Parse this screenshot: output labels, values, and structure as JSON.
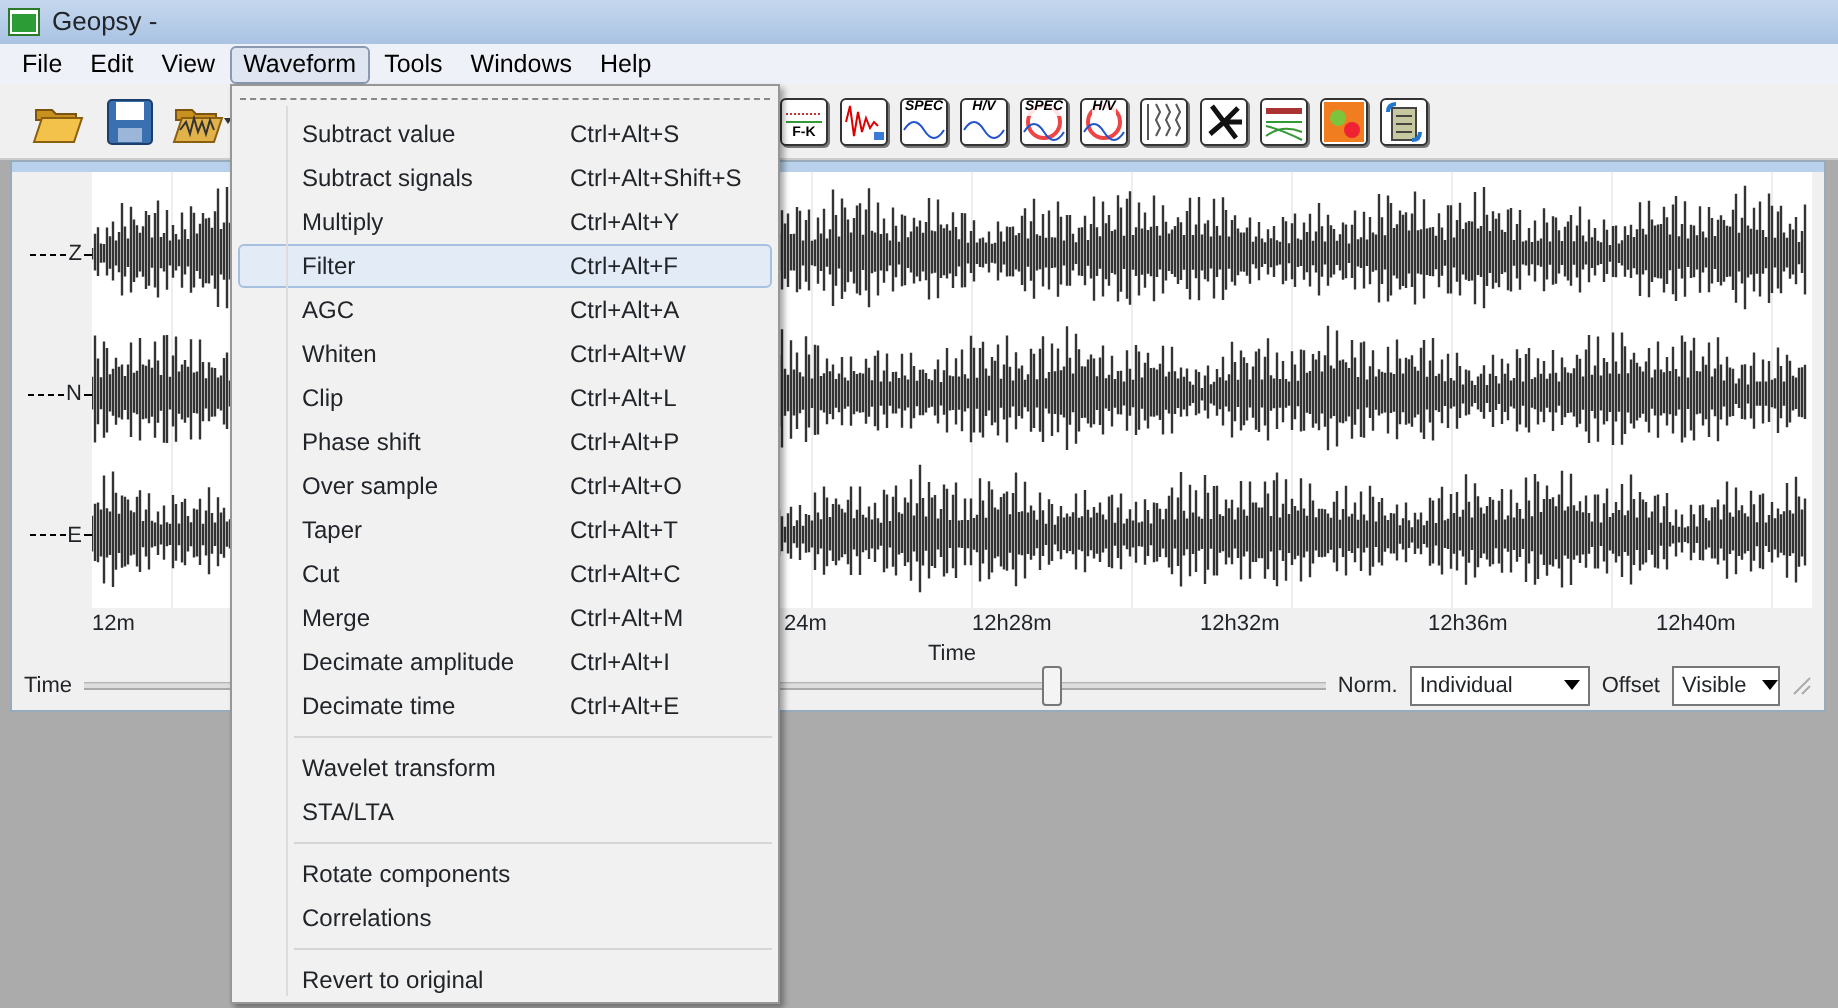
{
  "window": {
    "title": "Geopsy -"
  },
  "menubar": [
    {
      "label": "File",
      "selected": false
    },
    {
      "label": "Edit",
      "selected": false
    },
    {
      "label": "View",
      "selected": false
    },
    {
      "label": "Waveform",
      "selected": true
    },
    {
      "label": "Tools",
      "selected": false
    },
    {
      "label": "Windows",
      "selected": false
    },
    {
      "label": "Help",
      "selected": false
    }
  ],
  "toolbar": {
    "left": [
      {
        "kind": "open"
      },
      {
        "kind": "save"
      },
      {
        "kind": "load-signals"
      }
    ],
    "right": [
      {
        "kind": "fk",
        "label": "F-K"
      },
      {
        "kind": "damping"
      },
      {
        "kind": "spectrum",
        "label": "SPEC"
      },
      {
        "kind": "spectrum",
        "label": "H/V"
      },
      {
        "kind": "rotate-spectrum",
        "label": "SPEC"
      },
      {
        "kind": "rotate-spectrum",
        "label": "H/V"
      },
      {
        "kind": "traces"
      },
      {
        "kind": "polar"
      },
      {
        "kind": "dispersion"
      },
      {
        "kind": "map"
      },
      {
        "kind": "tables"
      }
    ]
  },
  "plot": {
    "traces": [
      {
        "label": "Z"
      },
      {
        "label": "N"
      },
      {
        "label": "E"
      }
    ],
    "x_ticks": [
      "12m",
      "24m",
      "12h28m",
      "12h32m",
      "12h36m",
      "12h40m"
    ],
    "x_title": "Time"
  },
  "controls": {
    "time_label": "Time",
    "time_slider": {
      "level": 0.78
    },
    "norm_label": "Norm.",
    "norm_value": "Individual",
    "offset_label": "Offset",
    "offset_value": "Visible"
  },
  "waveform_menu": {
    "groups": [
      [
        {
          "label": "Subtract value",
          "shortcut": "Ctrl+Alt+S",
          "selected": false
        },
        {
          "label": "Subtract signals",
          "shortcut": "Ctrl+Alt+Shift+S",
          "selected": false
        },
        {
          "label": "Multiply",
          "shortcut": "Ctrl+Alt+Y",
          "selected": false
        },
        {
          "label": "Filter",
          "shortcut": "Ctrl+Alt+F",
          "selected": true
        },
        {
          "label": "AGC",
          "shortcut": "Ctrl+Alt+A",
          "selected": false
        },
        {
          "label": "Whiten",
          "shortcut": "Ctrl+Alt+W",
          "selected": false
        },
        {
          "label": "Clip",
          "shortcut": "Ctrl+Alt+L",
          "selected": false
        },
        {
          "label": "Phase shift",
          "shortcut": "Ctrl+Alt+P",
          "selected": false
        },
        {
          "label": "Over sample",
          "shortcut": "Ctrl+Alt+O",
          "selected": false
        },
        {
          "label": "Taper",
          "shortcut": "Ctrl+Alt+T",
          "selected": false
        },
        {
          "label": "Cut",
          "shortcut": "Ctrl+Alt+C",
          "selected": false
        },
        {
          "label": "Merge",
          "shortcut": "Ctrl+Alt+M",
          "selected": false
        },
        {
          "label": "Decimate amplitude",
          "shortcut": "Ctrl+Alt+I",
          "selected": false
        },
        {
          "label": "Decimate time",
          "shortcut": "Ctrl+Alt+E",
          "selected": false
        }
      ],
      [
        {
          "label": "Wavelet transform",
          "selected": false
        },
        {
          "label": "STA/LTA",
          "selected": false
        }
      ],
      [
        {
          "label": "Rotate components",
          "selected": false
        },
        {
          "label": "Correlations",
          "selected": false
        }
      ],
      [
        {
          "label": "Revert to original",
          "selected": false
        }
      ]
    ]
  }
}
